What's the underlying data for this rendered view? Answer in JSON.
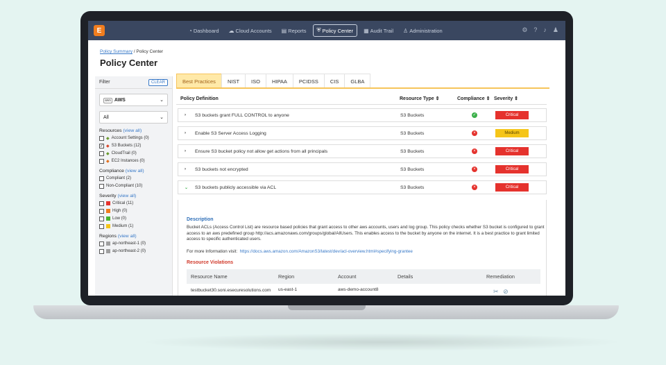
{
  "nav": {
    "logo": "E",
    "items": [
      {
        "icon": "◔",
        "label": "Dashboard",
        "active": false
      },
      {
        "icon": "☁",
        "label": "Cloud Accounts",
        "active": false
      },
      {
        "icon": "▤",
        "label": "Reports",
        "active": false
      },
      {
        "icon": "⛨",
        "label": "Policy Center",
        "active": true
      },
      {
        "icon": "▦",
        "label": "Audit Trail",
        "active": false
      },
      {
        "icon": "♙",
        "label": "Administration",
        "active": false
      }
    ]
  },
  "breadcrumb": {
    "link": "Policy Summary",
    "current": " / Policy Center"
  },
  "page_title": "Policy Center",
  "sidebar": {
    "filter_label": "Filter",
    "clear_label": "CLEAR",
    "cloud_select": "AWS",
    "cloud_badge": "aws",
    "scope_select": "All",
    "sections": [
      {
        "title": "Resources",
        "link": "(view all)",
        "items": [
          {
            "label": "Account Settings (0)",
            "checked": false,
            "icon": "key-icon",
            "color": "#6a9a2e"
          },
          {
            "label": "S3 Buckets (12)",
            "checked": true,
            "icon": "s3-icon",
            "color": "#d9472b"
          },
          {
            "label": "CloudTrail (0)",
            "checked": false,
            "icon": "cloudtrail-icon",
            "color": "#6a9a2e"
          },
          {
            "label": "EC2 Instances (0)",
            "checked": false,
            "icon": "ec2-icon",
            "color": "#e2701f"
          }
        ]
      },
      {
        "title": "Compliance",
        "link": "(view all)",
        "items": [
          {
            "label": "Compliant (2)",
            "checked": false
          },
          {
            "label": "Non-Compliant (10)",
            "checked": false
          }
        ]
      },
      {
        "title": "Severity",
        "link": "(view all)",
        "items": [
          {
            "label": "Critical (11)",
            "checked": false,
            "color": "#e5322d"
          },
          {
            "label": "High (0)",
            "checked": false,
            "color": "#f07d1e"
          },
          {
            "label": "Low (0)",
            "checked": false,
            "color": "#49b42f"
          },
          {
            "label": "Medium (1)",
            "checked": false,
            "color": "#f5c518"
          }
        ]
      },
      {
        "title": "Regions",
        "link": "(view all)",
        "items": [
          {
            "label": "ap-northeast-1 (0)",
            "checked": false,
            "color": "#a0a0a0"
          },
          {
            "label": "ap-northeast-2 (0)",
            "checked": false,
            "color": "#a0a0a0"
          }
        ]
      }
    ]
  },
  "tabs": [
    "Best Practices",
    "NIST",
    "ISO",
    "HIPAA",
    "PCIDSS",
    "CIS",
    "GLBA"
  ],
  "table": {
    "headers": {
      "definition": "Policy Definition",
      "resource_type": "Resource Type ⇕",
      "compliance": "Compliance ⇕",
      "severity": "Severity ⇕"
    },
    "rows": [
      {
        "policy": "S3 buckets grant FULL CONTROL to anyone",
        "resource_type": "S3 Buckets",
        "compliant": true,
        "severity": "Critical",
        "severity_color": "#e5322d"
      },
      {
        "policy": "Enable S3 Server Access Logging",
        "resource_type": "S3 Buckets",
        "compliant": false,
        "severity": "Medium",
        "severity_color": "#f5c518"
      },
      {
        "policy": "Ensure S3 bucket policy not allow get actions from all principals",
        "resource_type": "S3 Buckets",
        "compliant": false,
        "severity": "Critical",
        "severity_color": "#e5322d"
      },
      {
        "policy": "S3 buckets not encrypted",
        "resource_type": "S3 Buckets",
        "compliant": false,
        "severity": "Critical",
        "severity_color": "#e5322d"
      },
      {
        "policy": "S3 buckets publicly accessible via ACL",
        "resource_type": "S3 Buckets",
        "compliant": false,
        "severity": "Critical",
        "severity_color": "#e5322d"
      }
    ]
  },
  "expanded": {
    "desc_title": "Description",
    "desc_body": "Bucket ACLs (Access Control List) are resource based policies that grant access to other aws accounts, users and log group. This policy checks whether S3 bucket is configured to grant access to an aws predefined group http://acs.amazonaws.com/groups/global/AllUsers. This enables access to the bucket by anyone on the internet. It is a best practice to grant limited access to specific authenticated users.",
    "more_prefix": "For more Information visit:",
    "more_link": "https://docs.aws.amazon.com/AmazonS3/latest/dev/acl-overview.html#specifying-grantee",
    "violations_title": "Resource Violations",
    "violation_headers": {
      "name": "Resource Name",
      "region": "Region",
      "account": "Account",
      "details": "Details",
      "remediation": "Remediation"
    },
    "violation": {
      "name": "testbucket30.soni.esecuresolutions.com",
      "region": "us-east-1",
      "account": "aws-demo-account8"
    }
  },
  "colors": {
    "nav_bg": "#3a4760",
    "compliant": "#3bb04a",
    "non_compliant": "#e5322d",
    "tab_active_bg": "#ffe9a8"
  }
}
